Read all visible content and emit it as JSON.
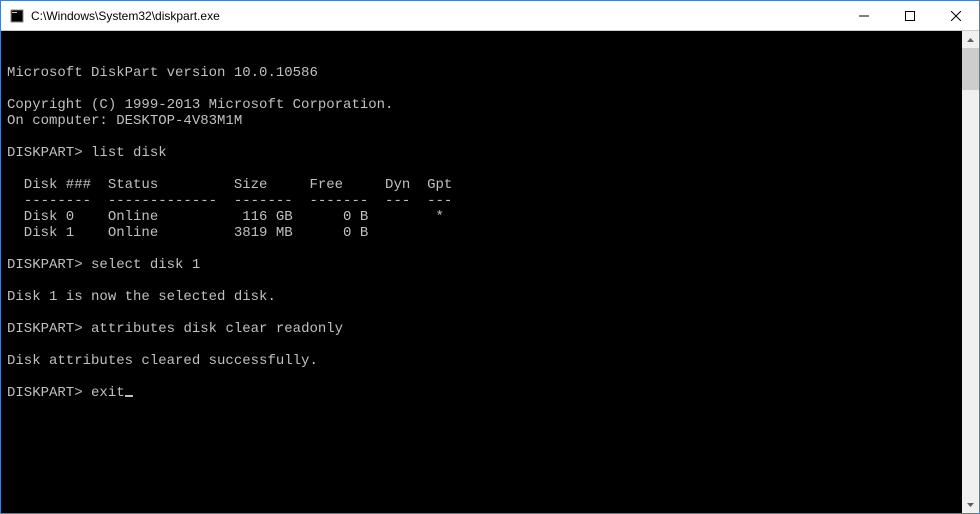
{
  "window": {
    "title": "C:\\Windows\\System32\\diskpart.exe"
  },
  "console": {
    "version_line": "Microsoft DiskPart version 10.0.10586",
    "copyright_line": "Copyright (C) 1999-2013 Microsoft Corporation.",
    "computer_line": "On computer: DESKTOP-4V83M1M",
    "prompt": "DISKPART>",
    "cmd_list_disk": "list disk",
    "table_header": "  Disk ###  Status         Size     Free     Dyn  Gpt",
    "table_divider": "  --------  -------------  -------  -------  ---  ---",
    "disk_rows": [
      "  Disk 0    Online          116 GB      0 B        *",
      "  Disk 1    Online         3819 MB      0 B"
    ],
    "cmd_select_disk": "select disk 1",
    "select_result": "Disk 1 is now the selected disk.",
    "cmd_attributes": "attributes disk clear readonly",
    "attributes_result": "Disk attributes cleared successfully.",
    "cmd_exit": "exit"
  }
}
